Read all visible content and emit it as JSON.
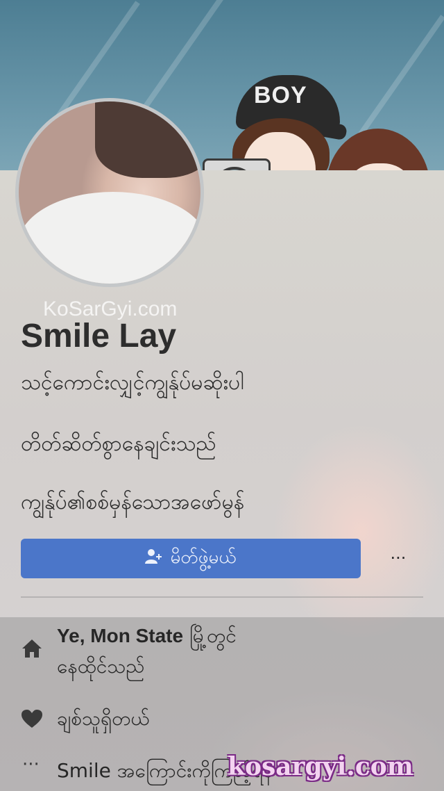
{
  "profile": {
    "watermark": "KoSarGyi.com",
    "name": "Smile Lay",
    "bio_lines": [
      "သင့်ကောင်းလျှင့်ကျွန်ုပ်မဆိုးပါ",
      "တိတ်ဆိတ်စွာနေချင်းသည်",
      "ကျွန်ုပ်၏စစ်မှန်သောအဖော်မွန်"
    ],
    "cover_cap_text": "BOY"
  },
  "actions": {
    "add_friend_label": "မိတ်ဖွဲ့မယ်",
    "more_label": "···"
  },
  "info": {
    "location_bold": "Ye, Mon State",
    "location_rest": " မြို့တွင်",
    "location_line2": "နေထိုင်သည်",
    "relationship": "ချစ်သူရှိတယ်",
    "about": "Smile အကြောင်းကိုကြည့်ရန်"
  },
  "brand_watermark": "kosargyi.com",
  "icons": {
    "home": "home-icon",
    "heart": "heart-icon",
    "more": "more-dots-icon",
    "add_friend": "add-friend-icon"
  },
  "colors": {
    "primary_button": "#4b76c9",
    "brand_fill": "#f3d3f0",
    "brand_outline": "#7a2a86"
  }
}
